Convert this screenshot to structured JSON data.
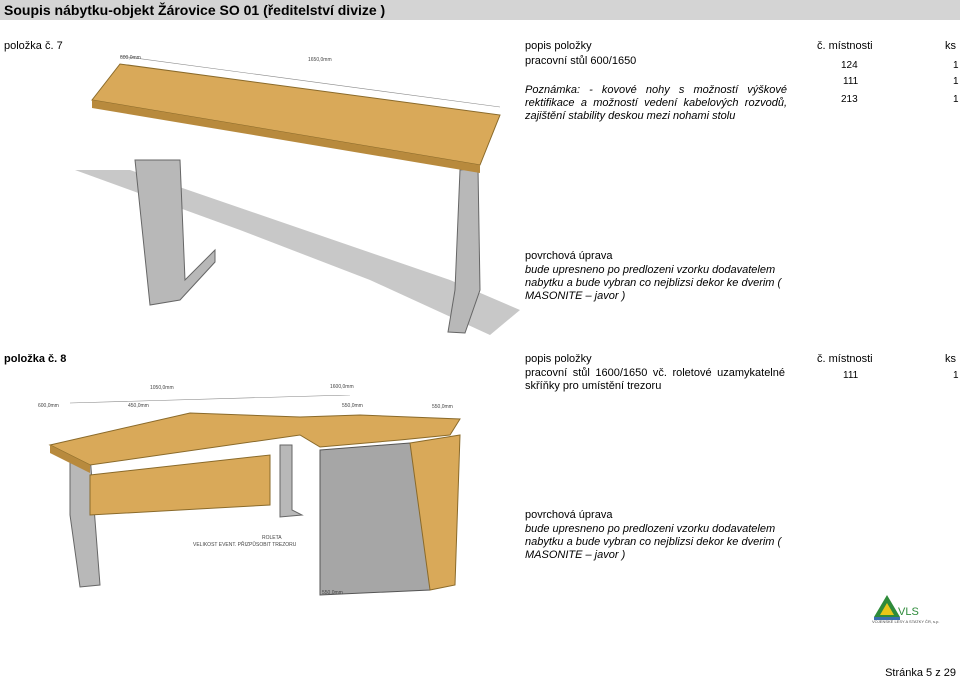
{
  "document": {
    "title": "Soupis nábytku-objekt Žárovice SO 01 (ředitelství divize )",
    "footer": "Stránka 5 z 29"
  },
  "items": [
    {
      "label": "položka č. 7",
      "desc_header": "popis položky",
      "room_header": "č. místnosti",
      "qty_header": "ks",
      "name": "pracovní stůl 600/1650",
      "note": "Poznámka: - kovové nohy s možností výškové rektifikace a možností vedení kabelových rozvodů, zajištění stability deskou mezi nohami stolu",
      "rooms": [
        {
          "room": "124",
          "qty": "1"
        },
        {
          "room": "111",
          "qty": "1"
        },
        {
          "room": "213",
          "qty": "1"
        }
      ],
      "surface_header": "povrchová úprava",
      "surface_text": "bude upresneno po predlozeni vzorku dodavatelem nabytku a bude vybran co nejblizsi dekor ke dverim ( MASONITE – javor )",
      "dims": [
        "600,0mm",
        "1650,0mm"
      ]
    },
    {
      "label": "položka č. 8",
      "desc_header": "popis položky",
      "room_header": "č. místnosti",
      "qty_header": "ks",
      "name": "pracovní stůl 1600/1650 vč. roletové uzamykatelné skříňky pro umístění trezoru",
      "rooms": [
        {
          "room": "111",
          "qty": "1"
        }
      ],
      "surface_header": "povrchová úprava",
      "surface_text": "bude upresneno po predlozeni vzorku dodavatelem nabytku a bude vybran co nejblizsi dekor ke dverim ( MASONITE – javor )",
      "dims": [
        "1050,0mm",
        "1600,0mm",
        "600,0mm",
        "450,0mm",
        "550,0mm",
        "550,0mm",
        "550,0mm"
      ],
      "drawing_note_1": "ROLETA",
      "drawing_note_2": "VELIKOST EVENT. PŘIZPŮSOBIT TREZORU"
    }
  ],
  "logo": {
    "text": "VLS",
    "subtext": "VOJENSKÉ LESY A STATKY ČR, s.p.",
    "colors": {
      "green": "#2e8b3a",
      "yellow": "#e8c619",
      "blue": "#3a6fb0"
    }
  },
  "colors": {
    "wood": "#d9a959",
    "wood_dark": "#b88a3d",
    "metal": "#b8b8b8",
    "shadow": "#c8c8c8"
  }
}
